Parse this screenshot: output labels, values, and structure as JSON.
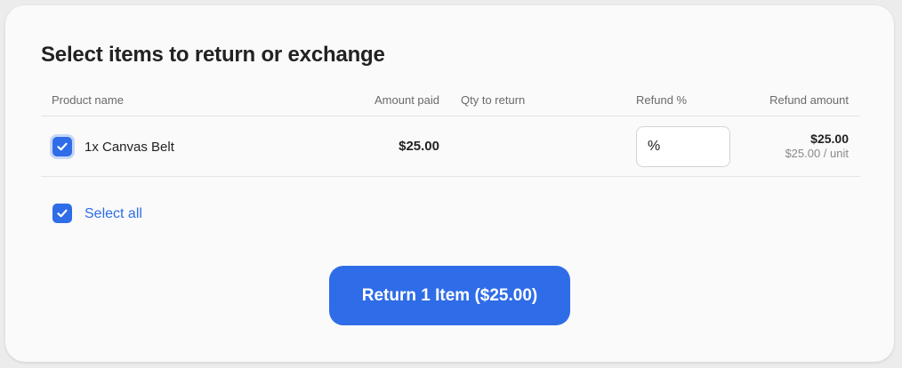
{
  "page": {
    "title": "Select items to return or exchange"
  },
  "table": {
    "headers": {
      "product": "Product name",
      "amount_paid": "Amount paid",
      "qty": "Qty to return",
      "refund_pct": "Refund %",
      "refund_amount": "Refund amount"
    },
    "rows": [
      {
        "checked": true,
        "product": "1x Canvas Belt",
        "amount_paid": "$25.00",
        "refund_pct_symbol": "%",
        "refund_amount": "$25.00",
        "refund_unit": "$25.00 / unit"
      }
    ]
  },
  "select_all": {
    "checked": true,
    "label": "Select all"
  },
  "actions": {
    "return_button": "Return 1 Item ($25.00)"
  },
  "icons": {
    "checkbox": "check-icon"
  },
  "colors": {
    "accent": "#2f6ce8",
    "card": "#fafafa",
    "background": "#ececec"
  }
}
